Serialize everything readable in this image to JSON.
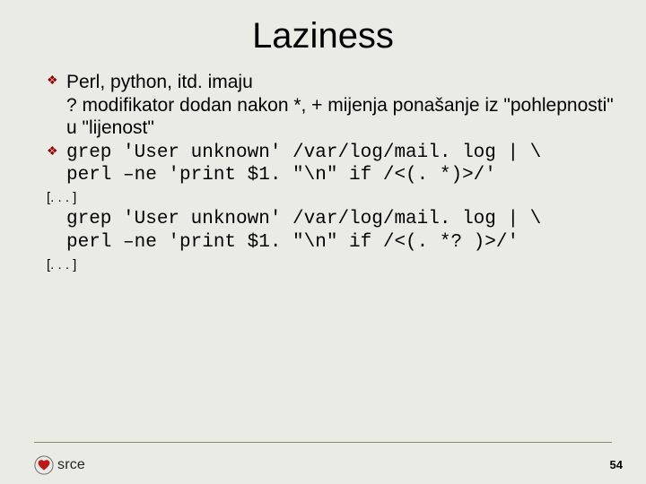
{
  "title": "Laziness",
  "bullets": {
    "b1": "Perl, python, itd. imaju\n?  modifikator dodan nakon *, + mijenja ponašanje iz \"pohlepnosti\" u \"lijenost\"",
    "b2_code": "grep 'User unknown' /var/log/mail. log | \\\nperl –ne 'print $1. \"\\n\" if /<(. *)>/'"
  },
  "ellipsis1": "[. . . ]",
  "code2": "grep 'User unknown' /var/log/mail. log | \\\nperl –ne 'print $1. \"\\n\" if /<(. *? )>/'",
  "ellipsis2": "[. . . ]",
  "brand": "srce",
  "page": "54"
}
